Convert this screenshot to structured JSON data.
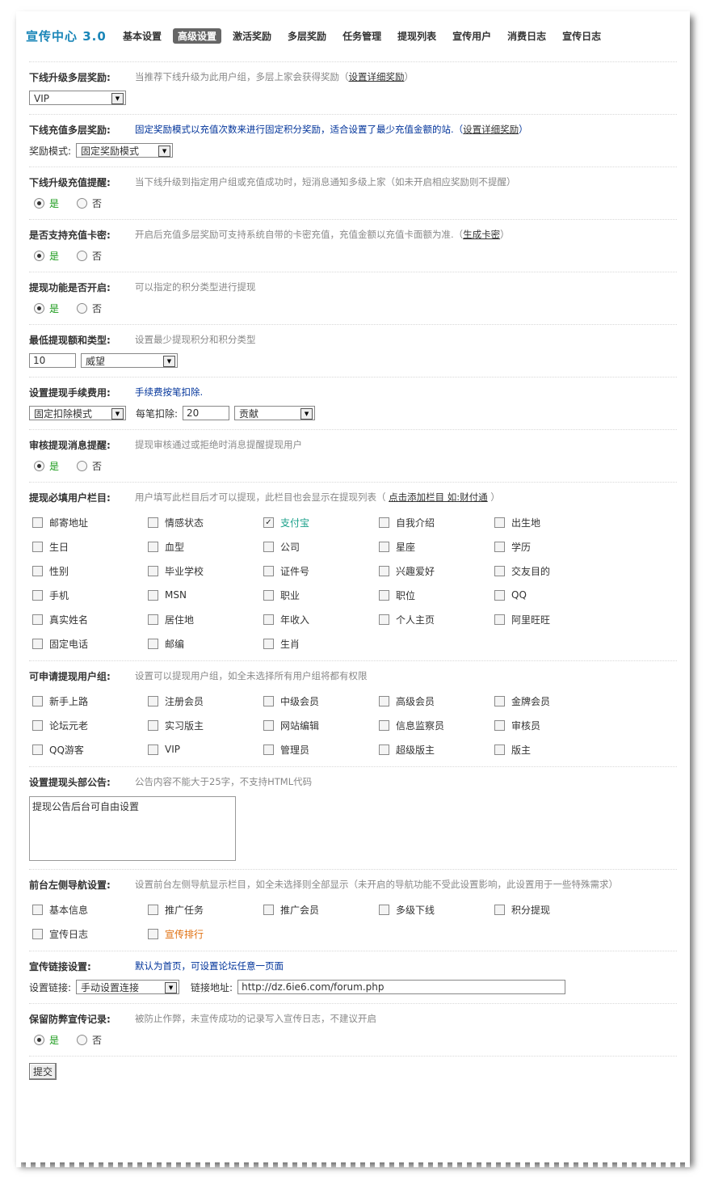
{
  "brand": "宣传中心 3.0",
  "nav": [
    "基本设置",
    "高级设置",
    "激活奖励",
    "多层奖励",
    "任务管理",
    "提现列表",
    "宣传用户",
    "消费日志",
    "宣传日志"
  ],
  "s1": {
    "label": "下线升级多层奖励:",
    "hint": "当推荐下线升级为此用户组，多层上家会获得奖励（",
    "link": "设置详细奖励",
    "hint_end": "）",
    "select": "VIP"
  },
  "s2": {
    "label": "下线充值多层奖励:",
    "hint": "固定奖励模式以充值次数来进行固定积分奖励，适合设置了最少充值金额的站.（",
    "link": "设置详细奖励",
    "hint_end": "）",
    "mode_label": "奖励模式:",
    "mode": "固定奖励模式"
  },
  "s3": {
    "label": "下线升级充值提醒:",
    "hint": "当下线升级到指定用户组或充值成功时，短消息通知多级上家（如未开启相应奖励则不提醒）",
    "yes": "是",
    "no": "否"
  },
  "s4": {
    "label": "是否支持充值卡密:",
    "hint": "开启后充值多层奖励可支持系统自带的卡密充值，充值金额以充值卡面额为准.（",
    "link": "生成卡密",
    "hint_end": "）",
    "yes": "是",
    "no": "否"
  },
  "s5": {
    "label": "提现功能是否开启:",
    "hint": "可以指定的积分类型进行提现",
    "yes": "是",
    "no": "否"
  },
  "s6": {
    "label": "最低提现额和类型:",
    "hint": "设置最少提现积分和积分类型",
    "amount": "10",
    "type": "威望"
  },
  "s7": {
    "label": "设置提现手续费用:",
    "hint": "手续费按笔扣除.",
    "mode": "固定扣除模式",
    "per_label": "每笔扣除:",
    "per_value": "20",
    "per_type": "贡献"
  },
  "s8": {
    "label": "审核提现消息提醒:",
    "hint": "提现审核通过或拒绝时消息提醒提现用户",
    "yes": "是",
    "no": "否"
  },
  "s9": {
    "label": "提现必填用户栏目:",
    "hint": "用户填写此栏目后才可以提现，此栏目也会显示在提现列表（ ",
    "link": "点击添加栏目 如:财付通",
    "hint_end": " ）",
    "items": [
      {
        "t": "邮寄地址",
        "c": false
      },
      {
        "t": "情感状态",
        "c": false
      },
      {
        "t": "支付宝",
        "c": true
      },
      {
        "t": "自我介绍",
        "c": false
      },
      {
        "t": "出生地",
        "c": false
      },
      {
        "t": "生日",
        "c": false
      },
      {
        "t": "血型",
        "c": false
      },
      {
        "t": "公司",
        "c": false
      },
      {
        "t": "星座",
        "c": false
      },
      {
        "t": "学历",
        "c": false
      },
      {
        "t": "性别",
        "c": false
      },
      {
        "t": "毕业学校",
        "c": false
      },
      {
        "t": "证件号",
        "c": false
      },
      {
        "t": "兴趣爱好",
        "c": false
      },
      {
        "t": "交友目的",
        "c": false
      },
      {
        "t": "手机",
        "c": false
      },
      {
        "t": "MSN",
        "c": false
      },
      {
        "t": "职业",
        "c": false
      },
      {
        "t": "职位",
        "c": false
      },
      {
        "t": "QQ",
        "c": false
      },
      {
        "t": "真实姓名",
        "c": false
      },
      {
        "t": "居住地",
        "c": false
      },
      {
        "t": "年收入",
        "c": false
      },
      {
        "t": "个人主页",
        "c": false
      },
      {
        "t": "阿里旺旺",
        "c": false
      },
      {
        "t": "固定电话",
        "c": false
      },
      {
        "t": "邮编",
        "c": false
      },
      {
        "t": "生肖",
        "c": false
      }
    ]
  },
  "s10": {
    "label": "可申请提现用户组:",
    "hint": "设置可以提现用户组，如全未选择所有用户组将都有权限",
    "items": [
      "新手上路",
      "注册会员",
      "中级会员",
      "高级会员",
      "金牌会员",
      "论坛元老",
      "实习版主",
      "网站编辑",
      "信息监察员",
      "审核员",
      "QQ游客",
      "VIP",
      "管理员",
      "超级版主",
      "版主"
    ]
  },
  "s11": {
    "label": "设置提现头部公告:",
    "hint": "公告内容不能大于25字，不支持HTML代码",
    "text": "提现公告后台可自由设置"
  },
  "s12": {
    "label": "前台左侧导航设置:",
    "hint": "设置前台左侧导航显示栏目，如全未选择则全部显示（未开启的导航功能不受此设置影响，此设置用于一些特殊需求）",
    "items": [
      "基本信息",
      "推广任务",
      "推广会员",
      "多级下线",
      "积分提现",
      "宣传日志",
      "宣传排行"
    ]
  },
  "s13": {
    "label": "宣传链接设置:",
    "hint": "默认为首页，可设置论坛任意一页面",
    "link_label": "设置链接:",
    "link_mode": "手动设置连接",
    "url_label": "链接地址:",
    "url": "http://dz.6ie6.com/forum.php"
  },
  "s14": {
    "label": "保留防弊宣传记录:",
    "hint": "被防止作弊，未宣传成功的记录写入宣传日志，不建议开启",
    "yes": "是",
    "no": "否"
  },
  "submit": "提交"
}
